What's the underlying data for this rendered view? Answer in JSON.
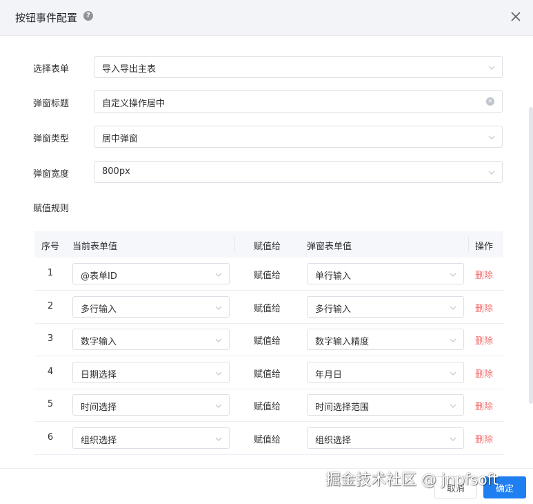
{
  "dialog": {
    "title": "按钮事件配置",
    "help_icon": "question-circle-icon",
    "close_icon": "close-icon"
  },
  "form": {
    "select_form": {
      "label": "选择表单",
      "value": "导入导出主表"
    },
    "popup_title": {
      "label": "弹窗标题",
      "value": "自定义操作居中"
    },
    "popup_type": {
      "label": "弹窗类型",
      "value": "居中弹窗"
    },
    "popup_width": {
      "label": "弹窗宽度",
      "value": "800px"
    }
  },
  "rules": {
    "label": "赋值规则",
    "headers": {
      "index": "序号",
      "current": "当前表单值",
      "assign": "赋值给",
      "popup": "弹窗表单值",
      "action": "操作"
    },
    "rows": [
      {
        "index": "1",
        "current": "@表单ID",
        "assign": "赋值给",
        "popup": "单行输入",
        "action": "删除"
      },
      {
        "index": "2",
        "current": "多行输入",
        "assign": "赋值给",
        "popup": "多行输入",
        "action": "删除"
      },
      {
        "index": "3",
        "current": "数字输入",
        "assign": "赋值给",
        "popup": "数字输入精度",
        "action": "删除"
      },
      {
        "index": "4",
        "current": "日期选择",
        "assign": "赋值给",
        "popup": "年月日",
        "action": "删除"
      },
      {
        "index": "5",
        "current": "时间选择",
        "assign": "赋值给",
        "popup": "时间选择范围",
        "action": "删除"
      },
      {
        "index": "6",
        "current": "组织选择",
        "assign": "赋值给",
        "popup": "组织选择",
        "action": "删除"
      }
    ]
  },
  "footer": {
    "cancel_label": "取消",
    "ok_label": "确定"
  },
  "watermark": "掘金技术社区 @ jnpfsoft",
  "colors": {
    "primary": "#1f7ff0",
    "danger": "#f56c6c",
    "border": "#dcdfe6",
    "header_bg": "#f2f4f7"
  }
}
